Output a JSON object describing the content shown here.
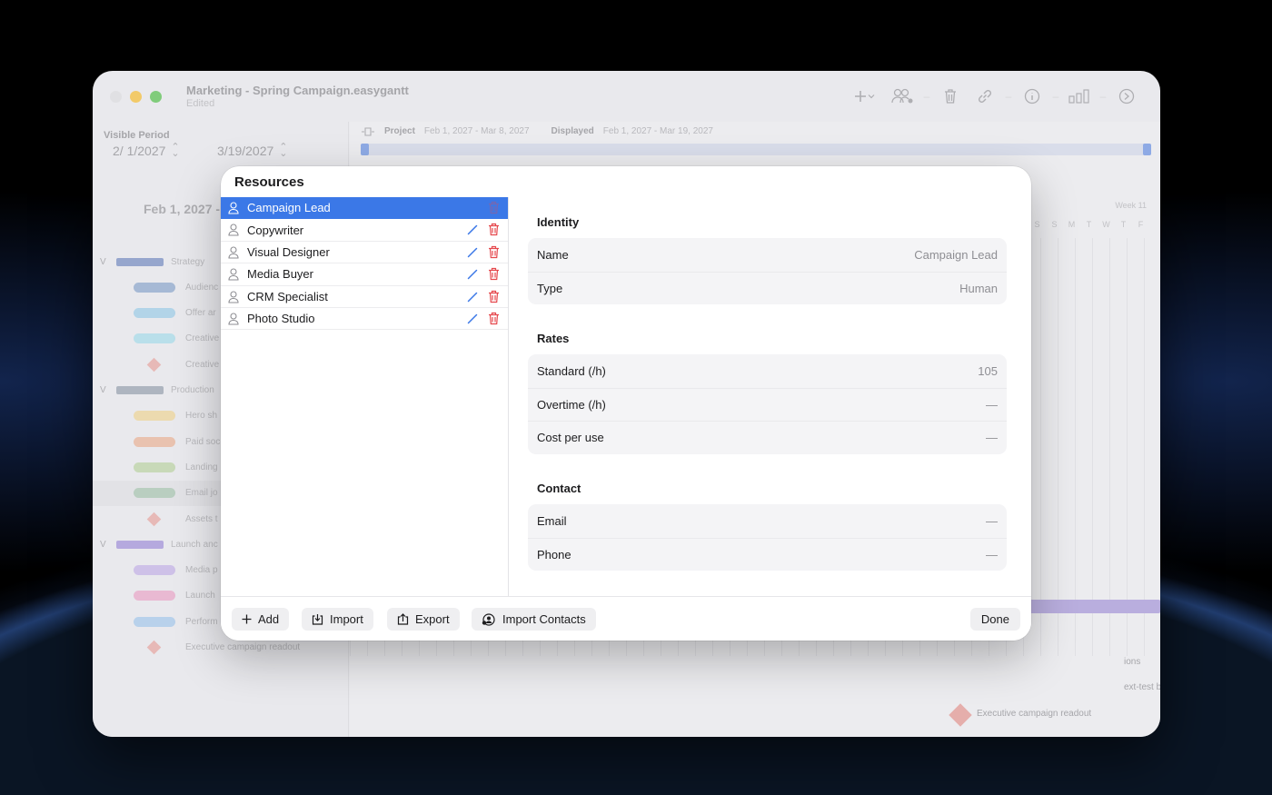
{
  "window": {
    "title": "Marketing - Spring Campaign.easygantt",
    "subtitle": "Edited"
  },
  "visible_period": {
    "label": "Visible Period",
    "start": "2/ 1/2027",
    "end": "3/19/2027"
  },
  "project_bar": {
    "project_label": "Project",
    "project_range": "Feb 1, 2027 - Mar 8, 2027",
    "displayed_label": "Displayed",
    "displayed_range": "Feb 1, 2027 - Mar 19, 2027"
  },
  "gantt": {
    "date_header": "Feb 1, 2027 -",
    "week_label": "Week 11",
    "day_letters": [
      "S",
      "S",
      "M",
      "T",
      "W",
      "T",
      "F"
    ],
    "tasks": [
      {
        "label": "Strategy",
        "kind": "group",
        "color": "#7a8fc2"
      },
      {
        "label": "Audienc",
        "kind": "task",
        "color": "#8fa8cc"
      },
      {
        "label": "Offer ar",
        "kind": "task",
        "color": "#9fcde6"
      },
      {
        "label": "Creative",
        "kind": "task",
        "color": "#a9dbe8"
      },
      {
        "label": "Creative",
        "kind": "milestone",
        "color": "#e6a8a4"
      },
      {
        "label": "Production",
        "kind": "group",
        "color": "#9aa3b0"
      },
      {
        "label": "Hero sh",
        "kind": "task",
        "color": "#ecd59a"
      },
      {
        "label": "Paid soc",
        "kind": "task",
        "color": "#e8b49a"
      },
      {
        "label": "Landing",
        "kind": "task",
        "color": "#bcd3a6"
      },
      {
        "label": "Email jo",
        "kind": "task",
        "color": "#a9c5b1"
      },
      {
        "label": "Assets t",
        "kind": "milestone",
        "color": "#e6a8a4"
      },
      {
        "label": "Launch anc",
        "kind": "group",
        "color": "#a393d8"
      },
      {
        "label": "Media p",
        "kind": "task",
        "color": "#c4b3e6"
      },
      {
        "label": "Launch",
        "kind": "task",
        "color": "#e8a9c9"
      },
      {
        "label": "Perform",
        "kind": "task",
        "color": "#a7c9ea"
      },
      {
        "label": "Executive campaign readout",
        "kind": "milestone",
        "color": "#e6a8a4"
      }
    ],
    "right_labels": {
      "ions": "ions",
      "backlog": "ext-test backlog",
      "readout": "Executive campaign readout"
    }
  },
  "sheet": {
    "title": "Resources",
    "resources": [
      {
        "name": "Campaign Lead",
        "selected": true
      },
      {
        "name": "Copywriter",
        "selected": false
      },
      {
        "name": "Visual Designer",
        "selected": false
      },
      {
        "name": "Media Buyer",
        "selected": false
      },
      {
        "name": "CRM Specialist",
        "selected": false
      },
      {
        "name": "Photo Studio",
        "selected": false
      }
    ],
    "identity": {
      "title": "Identity",
      "name_label": "Name",
      "name_value": "Campaign Lead",
      "type_label": "Type",
      "type_value": "Human"
    },
    "rates": {
      "title": "Rates",
      "standard_label": "Standard (/h)",
      "standard_value": "105",
      "overtime_label": "Overtime (/h)",
      "overtime_value": "—",
      "cost_label": "Cost per use",
      "cost_value": "—"
    },
    "contact": {
      "title": "Contact",
      "email_label": "Email",
      "email_value": "—",
      "phone_label": "Phone",
      "phone_value": "—"
    },
    "footer": {
      "add": "Add",
      "import": "Import",
      "export": "Export",
      "import_contacts": "Import Contacts",
      "done": "Done"
    }
  },
  "colors": {
    "accent": "#3b78e7",
    "delete": "#e5484d",
    "edit": "#3b78e7"
  }
}
